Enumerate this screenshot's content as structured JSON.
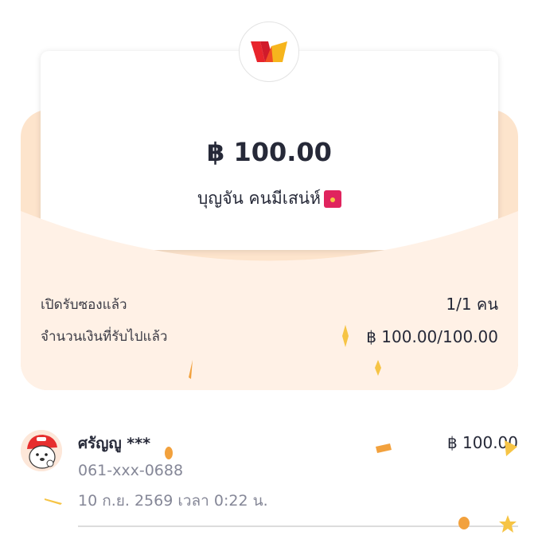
{
  "packet": {
    "amount": "฿ 100.00",
    "sender_name": "บุญจัน คนมีเสน่ห์",
    "sender_badge_icon": "red-envelope-icon",
    "logo_icon": "w-logo-icon"
  },
  "stats": [
    {
      "label": "เปิดรับซองแล้ว",
      "value": "1/1 คน"
    },
    {
      "label": "จำนวนเงินที่รับไปแล้ว",
      "value": "฿ 100.00/100.00"
    }
  ],
  "recipients": [
    {
      "name": "ศรัญญู ***",
      "phone": "061-xxx-0688",
      "datetime": "10 ก.ย. 2569 เวลา 0:22 น.",
      "amount": "฿ 100.00",
      "avatar_icon": "cartoon-avatar-icon"
    }
  ],
  "colors": {
    "envelope": "#fde4cc",
    "envelope_front": "#fff1e6",
    "text": "#262938",
    "muted": "#858797",
    "confetti_yellow": "#f6c445",
    "confetti_orange": "#f2a13d"
  }
}
